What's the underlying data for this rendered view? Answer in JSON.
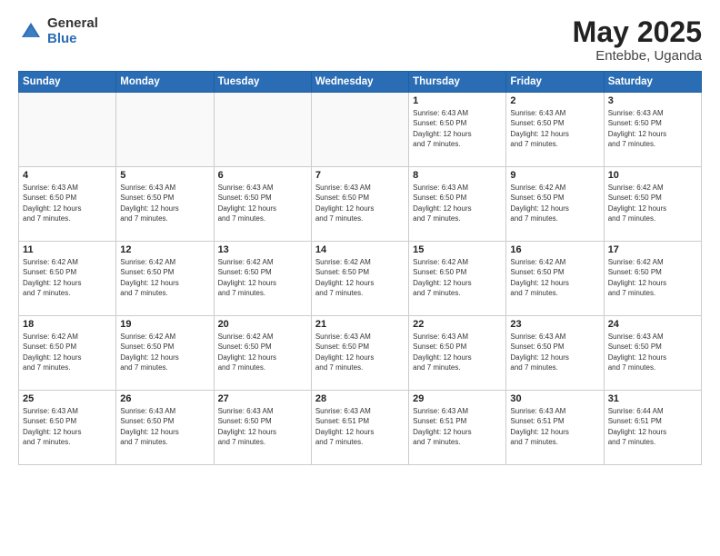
{
  "header": {
    "logo_general": "General",
    "logo_blue": "Blue",
    "title": "May 2025",
    "location": "Entebbe, Uganda"
  },
  "weekdays": [
    "Sunday",
    "Monday",
    "Tuesday",
    "Wednesday",
    "Thursday",
    "Friday",
    "Saturday"
  ],
  "weeks": [
    [
      {
        "day": "",
        "info": ""
      },
      {
        "day": "",
        "info": ""
      },
      {
        "day": "",
        "info": ""
      },
      {
        "day": "",
        "info": ""
      },
      {
        "day": "1",
        "info": "Sunrise: 6:43 AM\nSunset: 6:50 PM\nDaylight: 12 hours\nand 7 minutes."
      },
      {
        "day": "2",
        "info": "Sunrise: 6:43 AM\nSunset: 6:50 PM\nDaylight: 12 hours\nand 7 minutes."
      },
      {
        "day": "3",
        "info": "Sunrise: 6:43 AM\nSunset: 6:50 PM\nDaylight: 12 hours\nand 7 minutes."
      }
    ],
    [
      {
        "day": "4",
        "info": "Sunrise: 6:43 AM\nSunset: 6:50 PM\nDaylight: 12 hours\nand 7 minutes."
      },
      {
        "day": "5",
        "info": "Sunrise: 6:43 AM\nSunset: 6:50 PM\nDaylight: 12 hours\nand 7 minutes."
      },
      {
        "day": "6",
        "info": "Sunrise: 6:43 AM\nSunset: 6:50 PM\nDaylight: 12 hours\nand 7 minutes."
      },
      {
        "day": "7",
        "info": "Sunrise: 6:43 AM\nSunset: 6:50 PM\nDaylight: 12 hours\nand 7 minutes."
      },
      {
        "day": "8",
        "info": "Sunrise: 6:43 AM\nSunset: 6:50 PM\nDaylight: 12 hours\nand 7 minutes."
      },
      {
        "day": "9",
        "info": "Sunrise: 6:42 AM\nSunset: 6:50 PM\nDaylight: 12 hours\nand 7 minutes."
      },
      {
        "day": "10",
        "info": "Sunrise: 6:42 AM\nSunset: 6:50 PM\nDaylight: 12 hours\nand 7 minutes."
      }
    ],
    [
      {
        "day": "11",
        "info": "Sunrise: 6:42 AM\nSunset: 6:50 PM\nDaylight: 12 hours\nand 7 minutes."
      },
      {
        "day": "12",
        "info": "Sunrise: 6:42 AM\nSunset: 6:50 PM\nDaylight: 12 hours\nand 7 minutes."
      },
      {
        "day": "13",
        "info": "Sunrise: 6:42 AM\nSunset: 6:50 PM\nDaylight: 12 hours\nand 7 minutes."
      },
      {
        "day": "14",
        "info": "Sunrise: 6:42 AM\nSunset: 6:50 PM\nDaylight: 12 hours\nand 7 minutes."
      },
      {
        "day": "15",
        "info": "Sunrise: 6:42 AM\nSunset: 6:50 PM\nDaylight: 12 hours\nand 7 minutes."
      },
      {
        "day": "16",
        "info": "Sunrise: 6:42 AM\nSunset: 6:50 PM\nDaylight: 12 hours\nand 7 minutes."
      },
      {
        "day": "17",
        "info": "Sunrise: 6:42 AM\nSunset: 6:50 PM\nDaylight: 12 hours\nand 7 minutes."
      }
    ],
    [
      {
        "day": "18",
        "info": "Sunrise: 6:42 AM\nSunset: 6:50 PM\nDaylight: 12 hours\nand 7 minutes."
      },
      {
        "day": "19",
        "info": "Sunrise: 6:42 AM\nSunset: 6:50 PM\nDaylight: 12 hours\nand 7 minutes."
      },
      {
        "day": "20",
        "info": "Sunrise: 6:42 AM\nSunset: 6:50 PM\nDaylight: 12 hours\nand 7 minutes."
      },
      {
        "day": "21",
        "info": "Sunrise: 6:43 AM\nSunset: 6:50 PM\nDaylight: 12 hours\nand 7 minutes."
      },
      {
        "day": "22",
        "info": "Sunrise: 6:43 AM\nSunset: 6:50 PM\nDaylight: 12 hours\nand 7 minutes."
      },
      {
        "day": "23",
        "info": "Sunrise: 6:43 AM\nSunset: 6:50 PM\nDaylight: 12 hours\nand 7 minutes."
      },
      {
        "day": "24",
        "info": "Sunrise: 6:43 AM\nSunset: 6:50 PM\nDaylight: 12 hours\nand 7 minutes."
      }
    ],
    [
      {
        "day": "25",
        "info": "Sunrise: 6:43 AM\nSunset: 6:50 PM\nDaylight: 12 hours\nand 7 minutes."
      },
      {
        "day": "26",
        "info": "Sunrise: 6:43 AM\nSunset: 6:50 PM\nDaylight: 12 hours\nand 7 minutes."
      },
      {
        "day": "27",
        "info": "Sunrise: 6:43 AM\nSunset: 6:50 PM\nDaylight: 12 hours\nand 7 minutes."
      },
      {
        "day": "28",
        "info": "Sunrise: 6:43 AM\nSunset: 6:51 PM\nDaylight: 12 hours\nand 7 minutes."
      },
      {
        "day": "29",
        "info": "Sunrise: 6:43 AM\nSunset: 6:51 PM\nDaylight: 12 hours\nand 7 minutes."
      },
      {
        "day": "30",
        "info": "Sunrise: 6:43 AM\nSunset: 6:51 PM\nDaylight: 12 hours\nand 7 minutes."
      },
      {
        "day": "31",
        "info": "Sunrise: 6:44 AM\nSunset: 6:51 PM\nDaylight: 12 hours\nand 7 minutes."
      }
    ]
  ]
}
